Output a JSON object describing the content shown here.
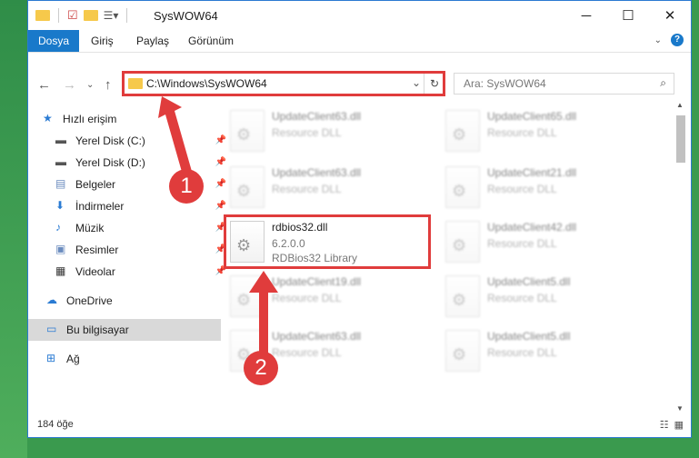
{
  "window": {
    "title": "SysWOW64",
    "controls": [
      "─",
      "☐",
      "✕"
    ]
  },
  "ribbon": {
    "tabs": [
      {
        "label": "Dosya",
        "active": true
      },
      {
        "label": "Giriş",
        "active": false
      },
      {
        "label": "Paylaş",
        "active": false
      },
      {
        "label": "Görünüm",
        "active": false
      }
    ],
    "help": "?"
  },
  "nav": {
    "address": "C:\\Windows\\SysWOW64",
    "search_placeholder": "Ara: SysWOW64"
  },
  "sidebar": {
    "items": [
      {
        "label": "Hızlı erişim",
        "icon": "star-icon",
        "pinned": false
      },
      {
        "label": "Yerel Disk (C:)",
        "icon": "drive-icon",
        "pinned": true
      },
      {
        "label": "Yerel Disk (D:)",
        "icon": "drive-icon",
        "pinned": true
      },
      {
        "label": "Belgeler",
        "icon": "documents-icon",
        "pinned": true
      },
      {
        "label": "İndirmeler",
        "icon": "download-icon",
        "pinned": true
      },
      {
        "label": "Müzik",
        "icon": "music-icon",
        "pinned": true
      },
      {
        "label": "Resimler",
        "icon": "pictures-icon",
        "pinned": true
      },
      {
        "label": "Videolar",
        "icon": "videos-icon",
        "pinned": true
      },
      {
        "label": "OneDrive",
        "icon": "cloud-icon",
        "pinned": false
      },
      {
        "label": "Bu bilgisayar",
        "icon": "computer-icon",
        "pinned": false,
        "selected": true
      },
      {
        "label": "Ağ",
        "icon": "network-icon",
        "pinned": false
      }
    ]
  },
  "files": {
    "left": [
      {
        "name": "UpdateClient63.dll",
        "line2": "Resource DLL"
      },
      {
        "name": "UpdateClient63.dll",
        "line2": "Resource DLL"
      },
      {
        "name": "rdbios32.dll",
        "line2": "6.2.0.0",
        "line3": "RDBios32 Library"
      },
      {
        "name": "UpdateClient19.dll",
        "line2": "Resource DLL"
      },
      {
        "name": "UpdateClient63.dll",
        "line2": "Resource DLL"
      }
    ],
    "right": [
      {
        "name": "UpdateClient65.dll",
        "line2": "Resource DLL"
      },
      {
        "name": "UpdateClient21.dll",
        "line2": "Resource DLL"
      },
      {
        "name": "UpdateClient42.dll",
        "line2": "Resource DLL"
      },
      {
        "name": "UpdateClient5.dll",
        "line2": "Resource DLL"
      },
      {
        "name": "UpdateClient5.dll",
        "line2": "Resource DLL"
      }
    ]
  },
  "status": {
    "count": "184 öğe"
  },
  "annotations": {
    "step1": "1",
    "step2": "2",
    "color": "#e03c3c"
  }
}
